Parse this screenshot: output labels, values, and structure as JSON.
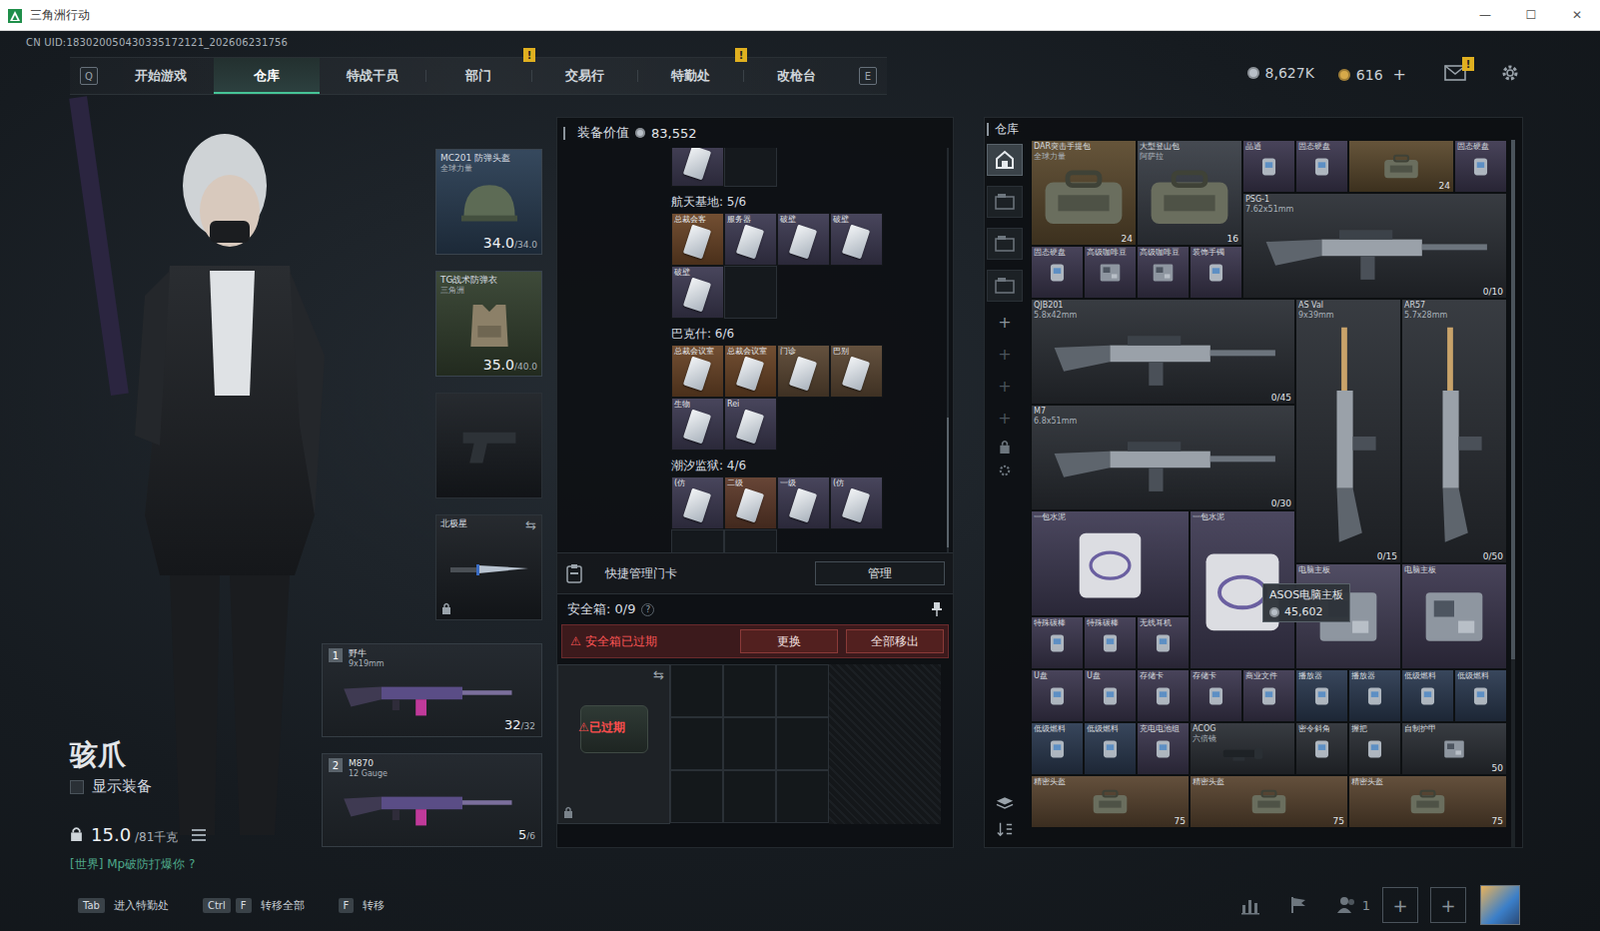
{
  "window": {
    "title": "三角洲行动",
    "controls": [
      "—",
      "☐",
      "✕"
    ]
  },
  "uid": "CN UID:183020050430335172121_202606231756",
  "nav": {
    "left_key": "Q",
    "right_key": "E",
    "tabs": [
      {
        "label": "开始游戏",
        "selected": false,
        "badge": null
      },
      {
        "label": "仓库",
        "selected": true,
        "badge": null
      },
      {
        "label": "特战干员",
        "selected": false,
        "badge": null
      },
      {
        "label": "部门",
        "selected": false,
        "badge": "!"
      },
      {
        "label": "交易行",
        "selected": false,
        "badge": null
      },
      {
        "label": "特勤处",
        "selected": false,
        "badge": "!"
      },
      {
        "label": "改枪台",
        "selected": false,
        "badge": null
      }
    ]
  },
  "currency": [
    {
      "amount": "8,627K",
      "color": "#b9c0c8",
      "add": null
    },
    {
      "amount": "616",
      "color": "#d6a94a",
      "add": "+"
    }
  ],
  "mail": {
    "badge": "!"
  },
  "operator": {
    "name": "骇爪",
    "show_gear": {
      "label": "显示装备",
      "checked": false
    },
    "weight": {
      "current": "15.0",
      "max": "/81千克"
    },
    "chat": "[世界] Mp破防打爆你 ?"
  },
  "equipment": {
    "helmet": {
      "name": "MC201 防弹头盔",
      "sub": "全球力量",
      "value": "34.0",
      "max": "/34.0",
      "color": "#2b3f55"
    },
    "armor": {
      "name": "TG战术防弹衣",
      "sub": "三角洲",
      "value": "35.0",
      "max": "/40.0",
      "color": "#34412f"
    },
    "pistol": {
      "empty": true
    },
    "melee": {
      "name": "北极星",
      "locked": true
    }
  },
  "weapons": [
    {
      "index": "1",
      "name": "野牛",
      "caliber": "9x19mm",
      "ammo": "32",
      "capacity": "/32"
    },
    {
      "index": "2",
      "name": "M870",
      "caliber": "12 Gauge",
      "ammo": "5",
      "capacity": "/6"
    }
  ],
  "loadout_value": {
    "label": "装备价值",
    "value": "83,552"
  },
  "keycards": {
    "cut_row": {
      "slots": 2,
      "cards": [
        {
          "label": "",
          "color": "#3d3a52"
        }
      ]
    },
    "sections": [
      {
        "title": "航天基地: 5/6",
        "slots": 6,
        "cards": [
          {
            "label": "总裁会客",
            "color": "#6a4426"
          },
          {
            "label": "服务器",
            "color": "#3d3a52"
          },
          {
            "label": "破壁",
            "color": "#3d3a52"
          },
          {
            "label": "破壁",
            "color": "#3d3a52"
          },
          {
            "label": "破壁",
            "color": "#3d3a52"
          }
        ]
      },
      {
        "title": "巴克什: 6/6",
        "slots": 6,
        "cards": [
          {
            "label": "总裁会议室",
            "color": "#6a4426"
          },
          {
            "label": "总裁会议室",
            "color": "#6a4426"
          },
          {
            "label": "门诊",
            "color": "#5a4632"
          },
          {
            "label": "巴别",
            "color": "#5a4632"
          },
          {
            "label": "生物",
            "color": "#3d3a52"
          },
          {
            "label": "Rei",
            "color": "#3d3a52"
          }
        ]
      },
      {
        "title": "潮汐监狱: 4/6",
        "slots": 6,
        "cards": [
          {
            "label": "(仿",
            "color": "#3d3a52"
          },
          {
            "label": "二级",
            "color": "#5e3a2a"
          },
          {
            "label": "一级",
            "color": "#3d3a52"
          },
          {
            "label": "(仿",
            "color": "#3d3a52"
          }
        ]
      }
    ],
    "manage_label": "快捷管理门卡",
    "manage_button": "管理"
  },
  "safe_box": {
    "label": "安全箱:",
    "count": "0/9",
    "help": "?",
    "warning": "安全箱已过期",
    "buttons": [
      "更换",
      "全部移出"
    ],
    "expired": true,
    "expired_label": "已过期"
  },
  "storage": {
    "title": "仓库",
    "tabs": [
      {
        "selected": true
      },
      {
        "selected": false
      },
      {
        "selected": false
      },
      {
        "selected": false
      }
    ],
    "items": [
      {
        "name": "DAR突击手提包",
        "sub": "全球力量",
        "count": "24",
        "kind": "bag",
        "color": "#5c4a2e"
      },
      {
        "name": "大型登山包",
        "sub": "阿萨拉",
        "count": "16",
        "kind": "bag",
        "color": "#3a3f47"
      },
      {
        "name": "晶通",
        "sub": null,
        "count": null,
        "kind": "small",
        "color": "#3d3850"
      },
      {
        "name": "固态硬盘",
        "sub": null,
        "count": null,
        "kind": "small",
        "color": "#3d3850"
      },
      {
        "name": "",
        "sub": null,
        "count": "24",
        "kind": "bag",
        "color": "#5c4a2e"
      },
      {
        "name": "固态硬盘",
        "sub": null,
        "count": null,
        "kind": "small",
        "color": "#3d3850"
      },
      {
        "name": "PSG-1",
        "sub": "7.62x51mm",
        "count": "0/10",
        "kind": "gun",
        "color": "#2c3036"
      },
      {
        "name": "固态硬盘",
        "sub": null,
        "count": null,
        "kind": "small",
        "color": "#3d3850"
      },
      {
        "name": "高级咖啡豆",
        "sub": null,
        "count": null,
        "kind": "box",
        "color": "#3d3850"
      },
      {
        "name": "高级咖啡豆",
        "sub": null,
        "count": null,
        "kind": "box",
        "color": "#3d3850"
      },
      {
        "name": "装饰手镯",
        "sub": null,
        "count": null,
        "kind": "small",
        "color": "#3d3850"
      },
      {
        "name": "QJB201",
        "sub": "5.8x42mm",
        "count": "0/45",
        "kind": "gun",
        "color": "#2c3036"
      },
      {
        "name": "AS Val",
        "sub": "9x39mm",
        "count": "0/15",
        "kind": "gun",
        "color": "#2c3036"
      },
      {
        "name": "AR57",
        "sub": "5.7x28mm",
        "count": "0/50",
        "kind": "gun",
        "color": "#2c3036"
      },
      {
        "name": "M7",
        "sub": "6.8x51mm",
        "count": "0/30",
        "kind": "gun",
        "color": "#2c3036"
      },
      {
        "name": "一包水泥",
        "sub": null,
        "count": null,
        "kind": "sack",
        "color": "#403c55"
      },
      {
        "name": "一包水泥",
        "sub": null,
        "count": null,
        "kind": "sack",
        "color": "#403c55"
      },
      {
        "name": "特殊碳棒",
        "sub": null,
        "count": null,
        "kind": "small",
        "color": "#3d3850"
      },
      {
        "name": "特殊碳棒",
        "sub": null,
        "count": null,
        "kind": "small",
        "color": "#3d3850"
      },
      {
        "name": "无线耳机",
        "sub": null,
        "count": null,
        "kind": "small",
        "color": "#3d3850"
      },
      {
        "name": "电脑主板",
        "sub": null,
        "count": null,
        "kind": "box",
        "color": "#46425a"
      },
      {
        "name": "电脑主板",
        "sub": null,
        "count": null,
        "kind": "box",
        "color": "#3d3850"
      },
      {
        "name": "U盘",
        "sub": null,
        "count": null,
        "kind": "small",
        "color": "#3d3850"
      },
      {
        "name": "U盘",
        "sub": null,
        "count": null,
        "kind": "small",
        "color": "#3d3850"
      },
      {
        "name": "存储卡",
        "sub": null,
        "count": null,
        "kind": "small",
        "color": "#3d3850"
      },
      {
        "name": "存储卡",
        "sub": null,
        "count": null,
        "kind": "small",
        "color": "#3d3850"
      },
      {
        "name": "商业文件",
        "sub": null,
        "count": null,
        "kind": "small",
        "color": "#3d3850"
      },
      {
        "name": "播放器",
        "sub": null,
        "count": null,
        "kind": "small",
        "color": "#2c3b52"
      },
      {
        "name": "播放器",
        "sub": null,
        "count": null,
        "kind": "small",
        "color": "#2c3b52"
      },
      {
        "name": "低级燃料",
        "sub": null,
        "count": null,
        "kind": "small",
        "color": "#2c3b52"
      },
      {
        "name": "低级燃料",
        "sub": null,
        "count": null,
        "kind": "small",
        "color": "#2c3b52"
      },
      {
        "name": "低级燃料",
        "sub": null,
        "count": null,
        "kind": "small",
        "color": "#2c3b52"
      },
      {
        "name": "低级燃料",
        "sub": null,
        "count": null,
        "kind": "small",
        "color": "#2c3b52"
      },
      {
        "name": "充电电池组",
        "sub": null,
        "count": null,
        "kind": "small",
        "color": "#3d3850"
      },
      {
        "name": "ACOG",
        "sub": "六倍镜",
        "count": null,
        "kind": "scope",
        "color": "#2c3036"
      },
      {
        "name": "密令斜角",
        "sub": null,
        "count": null,
        "kind": "small",
        "color": "#2c3036"
      },
      {
        "name": "握把",
        "sub": null,
        "count": null,
        "kind": "small",
        "color": "#2c3036"
      },
      {
        "name": "自制护甲",
        "sub": null,
        "count": "50",
        "kind": "box",
        "color": "#2c3036"
      },
      {
        "name": "精密头盔",
        "sub": null,
        "count": "75",
        "kind": "bag",
        "color": "#5a4530"
      },
      {
        "name": "精密头盔",
        "sub": null,
        "count": "75",
        "kind": "bag",
        "color": "#5a4530"
      },
      {
        "name": "精密头盔",
        "sub": null,
        "count": "75",
        "kind": "bag",
        "color": "#5a4530"
      }
    ],
    "tooltip": {
      "name": "ASOS电脑主板",
      "value": "45,602"
    }
  },
  "hints": [
    {
      "keys": [
        "Tab"
      ],
      "label": "进入特勤处"
    },
    {
      "keys": [
        "Ctrl",
        "F"
      ],
      "label": "转移全部"
    },
    {
      "keys": [
        "F"
      ],
      "label": "转移"
    }
  ],
  "team": {
    "count": "1",
    "slots": [
      "+",
      "+"
    ]
  }
}
